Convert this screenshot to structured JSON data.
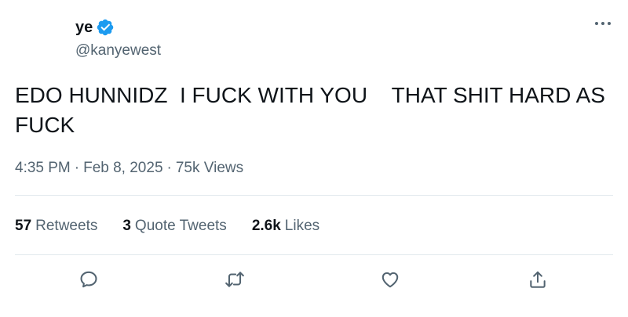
{
  "author": {
    "display_name": "ye",
    "handle": "@kanyewest",
    "verified_icon": "verified-badge-icon",
    "verified_color": "#1d9bf0"
  },
  "menu": {
    "icon": "more-horizontal-icon"
  },
  "tweet": {
    "text": "EDO HUNNIDZ  I FUCK WITH YOU    THAT SHIT HARD AS FUCK",
    "time": "4:35 PM",
    "date": "Feb 8, 2025",
    "views_count": "75k",
    "views_label": "Views",
    "separator": "·"
  },
  "stats": {
    "retweets_count": "57",
    "retweets_label": "Retweets",
    "quotes_count": "3",
    "quotes_label": "Quote Tweets",
    "likes_count": "2.6k",
    "likes_label": "Likes"
  },
  "actions": {
    "reply_icon": "reply-icon",
    "retweet_icon": "retweet-icon",
    "like_icon": "like-icon",
    "share_icon": "share-icon",
    "icon_color": "#536471"
  }
}
